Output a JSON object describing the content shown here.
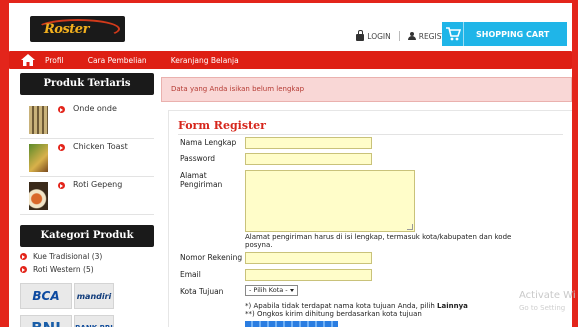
{
  "header": {
    "logo_text": "Roster",
    "login_label": "LOGIN",
    "register_label": "REGISTER",
    "cart_label": "SHOPPING CART"
  },
  "nav": {
    "items": [
      "Profil",
      "Cara Pembelian",
      "Keranjang Belanja"
    ]
  },
  "sidebar": {
    "produk_title": "Produk Terlaris",
    "produk": [
      "Onde onde",
      "Chicken Toast",
      "Roti Gepeng"
    ],
    "kategori_title": "Kategori Produk",
    "kategori": [
      "Kue Tradisional (3)",
      "Roti Western (5)"
    ],
    "banks": [
      "BCA",
      "mandiri",
      "BNI",
      "BANK BRI"
    ]
  },
  "alert": {
    "message": "Data yang Anda isikan belum lengkap"
  },
  "form": {
    "title": "Form Register",
    "nama_label": "Nama Lengkap",
    "password_label": "Password",
    "alamat_label": "Alamat Pengiriman",
    "alamat_hint": "Alamat pengiriman harus di isi lengkap, termasuk kota/kabupaten dan kode posyna.",
    "rekening_label": "Nomor Rekening",
    "email_label": "Email",
    "kota_label": "Kota Tujuan",
    "kota_selected": "- Pilih Kota -",
    "note_1_prefix": "*) Apabila tidak terdapat nama kota tujuan Anda, pilih ",
    "note_1_bold": "Lainnya",
    "note_2": "**) Ongkos kirim dihitung berdasarkan kota tujuan"
  },
  "watermark": {
    "line1": "Activate Wi",
    "line2": "Go to Setting"
  },
  "colors": {
    "brand_red": "#e3251b",
    "cart_blue": "#1fb5e8",
    "input_yellow": "#fffdc9"
  }
}
